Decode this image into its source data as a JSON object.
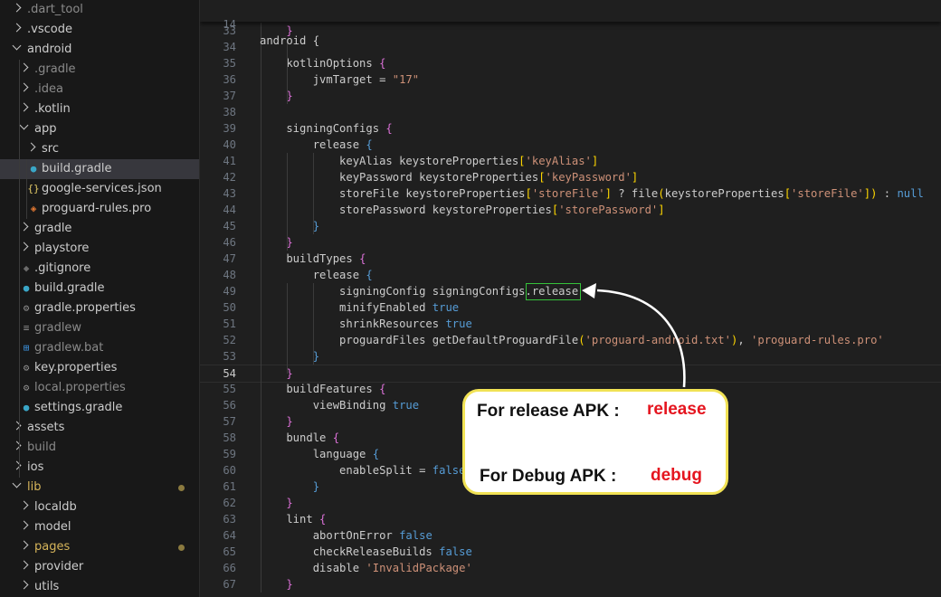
{
  "explorer": {
    "items": [
      {
        "label": ".dart_tool",
        "depth": 0,
        "type": "folder",
        "open": false,
        "dim": true
      },
      {
        "label": ".vscode",
        "depth": 0,
        "type": "folder",
        "open": false
      },
      {
        "label": "android",
        "depth": 0,
        "type": "folder",
        "open": true
      },
      {
        "label": ".gradle",
        "depth": 1,
        "type": "folder",
        "open": false,
        "dim": true
      },
      {
        "label": ".idea",
        "depth": 1,
        "type": "folder",
        "open": false,
        "dim": true
      },
      {
        "label": ".kotlin",
        "depth": 1,
        "type": "folder",
        "open": false
      },
      {
        "label": "app",
        "depth": 1,
        "type": "folder",
        "open": true
      },
      {
        "label": "src",
        "depth": 2,
        "type": "folder",
        "open": false
      },
      {
        "label": "build.gradle",
        "depth": 2,
        "type": "file",
        "icon": "gradle-icon",
        "selected": true
      },
      {
        "label": "google-services.json",
        "depth": 2,
        "type": "file",
        "icon": "json-icon"
      },
      {
        "label": "proguard-rules.pro",
        "depth": 2,
        "type": "file",
        "icon": "pro-icon"
      },
      {
        "label": "gradle",
        "depth": 1,
        "type": "folder",
        "open": false
      },
      {
        "label": "playstore",
        "depth": 1,
        "type": "folder",
        "open": false
      },
      {
        "label": ".gitignore",
        "depth": 1,
        "type": "file",
        "icon": "git-icon"
      },
      {
        "label": "build.gradle",
        "depth": 1,
        "type": "file",
        "icon": "gradle-icon"
      },
      {
        "label": "gradle.properties",
        "depth": 1,
        "type": "file",
        "icon": "settings-file-icon"
      },
      {
        "label": "gradlew",
        "depth": 1,
        "type": "file",
        "icon": "file-icon",
        "dim": true
      },
      {
        "label": "gradlew.bat",
        "depth": 1,
        "type": "file",
        "icon": "windows-icon",
        "dim": true
      },
      {
        "label": "key.properties",
        "depth": 1,
        "type": "file",
        "icon": "settings-file-icon"
      },
      {
        "label": "local.properties",
        "depth": 1,
        "type": "file",
        "icon": "settings-file-icon",
        "dim": true
      },
      {
        "label": "settings.gradle",
        "depth": 1,
        "type": "file",
        "icon": "gradle-icon"
      },
      {
        "label": "assets",
        "depth": 0,
        "type": "folder",
        "open": false
      },
      {
        "label": "build",
        "depth": 0,
        "type": "folder",
        "open": false,
        "dim": true
      },
      {
        "label": "ios",
        "depth": 0,
        "type": "folder",
        "open": false
      },
      {
        "label": "lib",
        "depth": 0,
        "type": "folder",
        "open": true,
        "modified": true
      },
      {
        "label": "localdb",
        "depth": 1,
        "type": "folder",
        "open": false
      },
      {
        "label": "model",
        "depth": 1,
        "type": "folder",
        "open": false
      },
      {
        "label": "pages",
        "depth": 1,
        "type": "folder",
        "open": false,
        "modified": true
      },
      {
        "label": "provider",
        "depth": 1,
        "type": "folder",
        "open": false
      },
      {
        "label": "utils",
        "depth": 1,
        "type": "folder",
        "open": false
      }
    ]
  },
  "editor": {
    "sticky": {
      "num": "14",
      "text": "android {"
    },
    "lines": [
      {
        "num": "33",
        "tokens": [
          [
            "    ",
            ""
          ],
          [
            "}",
            "br"
          ]
        ]
      },
      {
        "num": "34",
        "tokens": []
      },
      {
        "num": "35",
        "tokens": [
          [
            "    kotlinOptions ",
            ""
          ],
          [
            "{",
            "br"
          ]
        ]
      },
      {
        "num": "36",
        "tokens": [
          [
            "        jvmTarget = ",
            ""
          ],
          [
            "\"17\"",
            "str"
          ]
        ]
      },
      {
        "num": "37",
        "tokens": [
          [
            "    ",
            ""
          ],
          [
            "}",
            "br"
          ]
        ]
      },
      {
        "num": "38",
        "tokens": []
      },
      {
        "num": "39",
        "tokens": [
          [
            "    signingConfigs ",
            ""
          ],
          [
            "{",
            "br"
          ]
        ]
      },
      {
        "num": "40",
        "tokens": [
          [
            "        release ",
            ""
          ],
          [
            "{",
            "kw"
          ]
        ]
      },
      {
        "num": "41",
        "tokens": [
          [
            "            keyAlias keystoreProperties",
            ""
          ],
          [
            "[",
            "sq"
          ],
          [
            "'keyAlias'",
            "str"
          ],
          [
            "]",
            "sq"
          ]
        ]
      },
      {
        "num": "42",
        "tokens": [
          [
            "            keyPassword keystoreProperties",
            ""
          ],
          [
            "[",
            "sq"
          ],
          [
            "'keyPassword'",
            "str"
          ],
          [
            "]",
            "sq"
          ]
        ]
      },
      {
        "num": "43",
        "tokens": [
          [
            "            storeFile keystoreProperties",
            ""
          ],
          [
            "[",
            "sq"
          ],
          [
            "'storeFile'",
            "str"
          ],
          [
            "]",
            "sq"
          ],
          [
            " ? file",
            ""
          ],
          [
            "(",
            "br2"
          ],
          [
            "keystoreProperties",
            ""
          ],
          [
            "[",
            "sq"
          ],
          [
            "'storeFile'",
            "str"
          ],
          [
            "]",
            "sq"
          ],
          [
            ")",
            "br2"
          ],
          [
            " : ",
            ""
          ],
          [
            "null",
            "kw"
          ]
        ]
      },
      {
        "num": "44",
        "tokens": [
          [
            "            storePassword keystoreProperties",
            ""
          ],
          [
            "[",
            "sq"
          ],
          [
            "'storePassword'",
            "str"
          ],
          [
            "]",
            "sq"
          ]
        ]
      },
      {
        "num": "45",
        "tokens": [
          [
            "        ",
            ""
          ],
          [
            "}",
            "kw"
          ]
        ]
      },
      {
        "num": "46",
        "tokens": [
          [
            "    ",
            ""
          ],
          [
            "}",
            "br"
          ]
        ]
      },
      {
        "num": "47",
        "tokens": [
          [
            "    buildTypes ",
            ""
          ],
          [
            "{",
            "br"
          ]
        ]
      },
      {
        "num": "48",
        "tokens": [
          [
            "        release ",
            ""
          ],
          [
            "{",
            "kw"
          ]
        ]
      },
      {
        "num": "49",
        "tokens": [
          [
            "            signingConfig signingConfigs.release",
            ""
          ]
        ]
      },
      {
        "num": "50",
        "tokens": [
          [
            "            minifyEnabled ",
            ""
          ],
          [
            "true",
            "kw"
          ]
        ]
      },
      {
        "num": "51",
        "tokens": [
          [
            "            shrinkResources ",
            ""
          ],
          [
            "true",
            "kw"
          ]
        ]
      },
      {
        "num": "52",
        "tokens": [
          [
            "            proguardFiles getDefaultProguardFile",
            ""
          ],
          [
            "(",
            "br2"
          ],
          [
            "'proguard-android.txt'",
            "str"
          ],
          [
            ")",
            "br2"
          ],
          [
            ", ",
            ""
          ],
          [
            "'proguard-rules.pro'",
            "str"
          ]
        ]
      },
      {
        "num": "53",
        "tokens": [
          [
            "        ",
            ""
          ],
          [
            "}",
            "kw"
          ]
        ]
      },
      {
        "num": "54",
        "tokens": [
          [
            "    ",
            ""
          ],
          [
            "}",
            "br"
          ]
        ],
        "current": true
      },
      {
        "num": "55",
        "tokens": [
          [
            "    buildFeatures ",
            ""
          ],
          [
            "{",
            "br"
          ]
        ]
      },
      {
        "num": "56",
        "tokens": [
          [
            "        viewBinding ",
            ""
          ],
          [
            "true",
            "kw"
          ]
        ]
      },
      {
        "num": "57",
        "tokens": [
          [
            "    ",
            ""
          ],
          [
            "}",
            "br"
          ]
        ]
      },
      {
        "num": "58",
        "tokens": [
          [
            "    bundle ",
            ""
          ],
          [
            "{",
            "br"
          ]
        ]
      },
      {
        "num": "59",
        "tokens": [
          [
            "        language ",
            ""
          ],
          [
            "{",
            "kw"
          ]
        ]
      },
      {
        "num": "60",
        "tokens": [
          [
            "            enableSplit = ",
            ""
          ],
          [
            "false",
            "kw"
          ]
        ]
      },
      {
        "num": "61",
        "tokens": [
          [
            "        ",
            ""
          ],
          [
            "}",
            "kw"
          ]
        ]
      },
      {
        "num": "62",
        "tokens": [
          [
            "    ",
            ""
          ],
          [
            "}",
            "br"
          ]
        ]
      },
      {
        "num": "63",
        "tokens": [
          [
            "    lint ",
            ""
          ],
          [
            "{",
            "br"
          ]
        ]
      },
      {
        "num": "64",
        "tokens": [
          [
            "        abortOnError ",
            ""
          ],
          [
            "false",
            "kw"
          ]
        ]
      },
      {
        "num": "65",
        "tokens": [
          [
            "        checkReleaseBuilds ",
            ""
          ],
          [
            "false",
            "kw"
          ]
        ]
      },
      {
        "num": "66",
        "tokens": [
          [
            "        disable ",
            ""
          ],
          [
            "'InvalidPackage'",
            "str"
          ]
        ]
      },
      {
        "num": "67",
        "tokens": [
          [
            "    ",
            ""
          ],
          [
            "}",
            "br"
          ]
        ]
      }
    ]
  },
  "callout": {
    "release_label": "For release APK :",
    "release_value": "release",
    "debug_label": "For Debug APK :",
    "debug_value": "debug"
  },
  "colors": {
    "highlight_box": "#35c23a",
    "callout_border": "#f1e255",
    "callout_value": "#e5151f"
  }
}
